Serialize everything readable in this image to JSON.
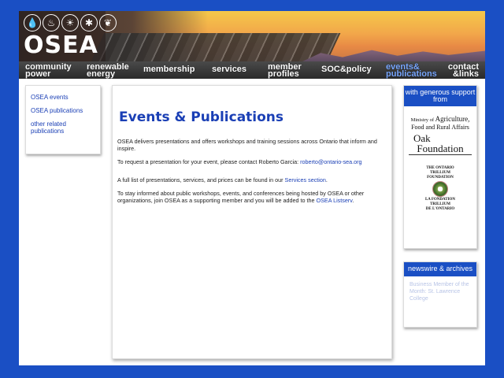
{
  "logo": {
    "icons": [
      "water-drop-icon",
      "flame-icon",
      "sun-icon",
      "wind-icon",
      "leaf-icon",
      "cloud-icon"
    ],
    "text": "OSEA"
  },
  "nav": {
    "items": [
      {
        "label": "community\npower"
      },
      {
        "label": "renewable\nenergy"
      },
      {
        "label": "membership"
      },
      {
        "label": "services"
      },
      {
        "label": "member\nprofiles"
      },
      {
        "label": "SOC&policy"
      },
      {
        "label": "events&\npublications"
      },
      {
        "label": "contact\n&links"
      }
    ]
  },
  "sidebar": {
    "links": [
      {
        "label": "OSEA events"
      },
      {
        "label": "OSEA publications"
      },
      {
        "label": "other related publications"
      }
    ]
  },
  "main": {
    "title": "Events & Publications",
    "p1": "OSEA delivers presentations and offers workshops and training sessions across Ontario that inform and inspire.",
    "p2_text": "To request a presentation for your event, please contact Roberto Garcia: ",
    "p2_link": "roberto@ontario-sea.org",
    "p3_text": "A full list of presentations, services, and prices can be found in our ",
    "p3_link": "Services section",
    "p3_end": ".",
    "p4_text": "To stay informed about public workshops, events, and conferences being hosted by OSEA or other organizations, join OSEA as a supporting member and you will be added to the ",
    "p4_link": "OSEA Listserv",
    "p4_end": "."
  },
  "support": {
    "heading": "with generous support from",
    "ministry_small": "Ministry of",
    "ministry_big": "Agriculture,",
    "ministry_line2": "Food and Rural Affairs",
    "oak_line1": "Oak",
    "oak_line2": "Foundation",
    "trillium_en1": "THE ONTARIO",
    "trillium_en2": "TRILLIUM",
    "trillium_en3": "FOUNDATION",
    "trillium_fr1": "LA FONDATION",
    "trillium_fr2": "TRILLIUM",
    "trillium_fr3": "DE L'ONTARIO"
  },
  "newswire": {
    "heading": "newswire & archives",
    "item": "Business Member of the Month: St. Lawrence College"
  }
}
